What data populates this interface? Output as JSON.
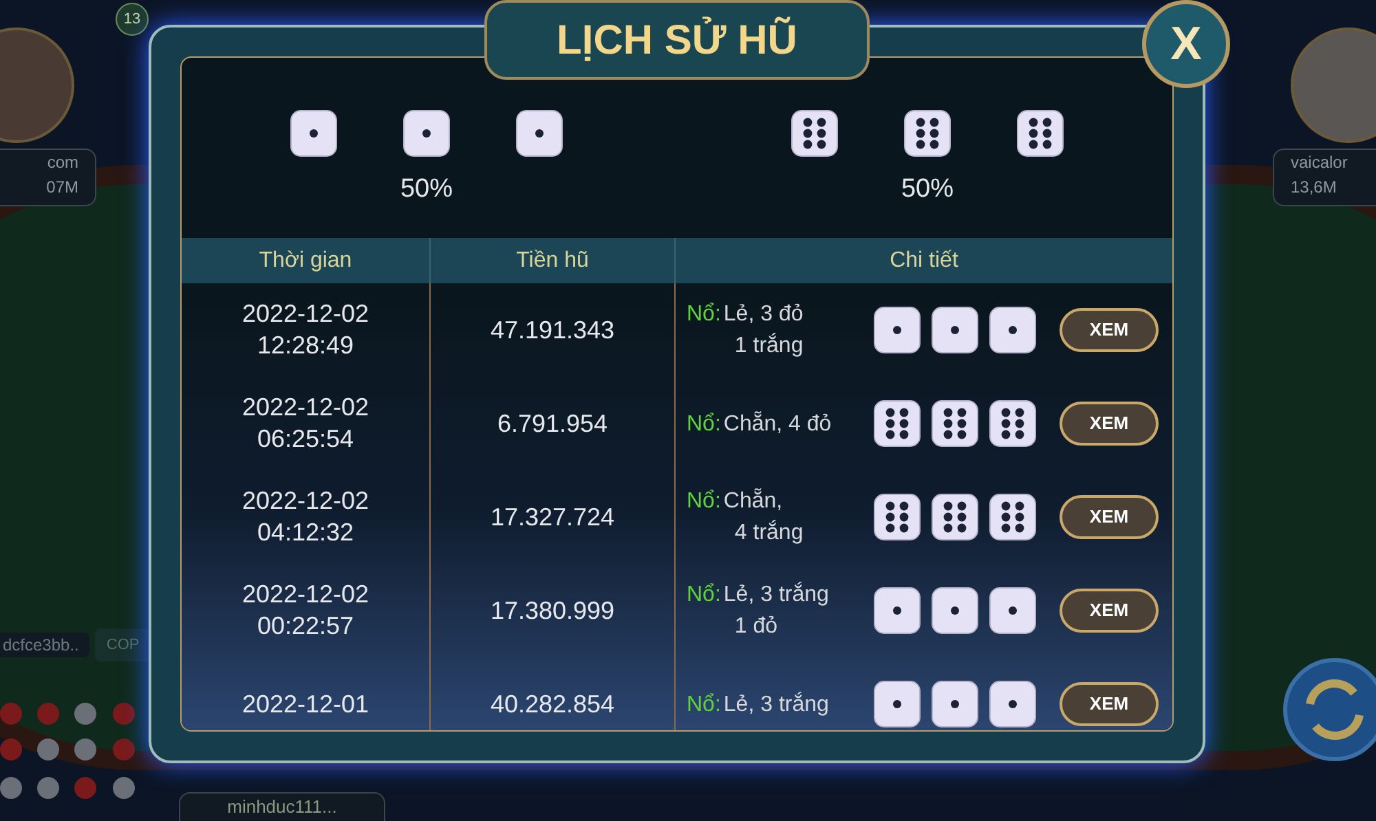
{
  "background": {
    "left_player": {
      "name": "com",
      "balance": "07M",
      "level": "13"
    },
    "right_player": {
      "name": "vaicalor",
      "balance": "13,6M"
    },
    "room_code": "dcfce3bb..",
    "copy_button": "COP",
    "bottom_player": "minhduc111..."
  },
  "dialog": {
    "title": "LỊCH SỬ HŨ",
    "close": "X",
    "jackpots": [
      {
        "dice": [
          {
            "kind": "one"
          },
          {
            "kind": "one"
          },
          {
            "kind": "one"
          }
        ],
        "chance": "50%"
      },
      {
        "dice": [
          {
            "kind": "six"
          },
          {
            "kind": "six"
          },
          {
            "kind": "six"
          }
        ],
        "chance": "50%"
      }
    ],
    "table": {
      "columns": [
        "Thời gian",
        "Tiền hũ",
        "Chi tiết"
      ],
      "rows": [
        {
          "date": "2022-12-02",
          "time": "12:28:49",
          "amount": "47.191.343",
          "prefix": "Nổ:",
          "lines": [
            "Lẻ, 3 đỏ",
            "1 trắng"
          ],
          "dice": [
            {
              "kind": "one"
            },
            {
              "kind": "one"
            },
            {
              "kind": "one"
            }
          ],
          "button": "XEM"
        },
        {
          "date": "2022-12-02",
          "time": "06:25:54",
          "amount": "6.791.954",
          "prefix": "Nổ:",
          "lines": [
            "Chẵn, 4 đỏ"
          ],
          "dice": [
            {
              "kind": "six"
            },
            {
              "kind": "six"
            },
            {
              "kind": "six"
            }
          ],
          "button": "XEM"
        },
        {
          "date": "2022-12-02",
          "time": "04:12:32",
          "amount": "17.327.724",
          "prefix": "Nổ:",
          "lines": [
            "Chẵn,",
            "4 trắng"
          ],
          "dice": [
            {
              "kind": "six"
            },
            {
              "kind": "six"
            },
            {
              "kind": "six"
            }
          ],
          "button": "XEM"
        },
        {
          "date": "2022-12-02",
          "time": "00:22:57",
          "amount": "17.380.999",
          "prefix": "Nổ:",
          "lines": [
            "Lẻ, 3 trắng",
            "1 đỏ"
          ],
          "dice": [
            {
              "kind": "one"
            },
            {
              "kind": "one"
            },
            {
              "kind": "one"
            }
          ],
          "button": "XEM"
        },
        {
          "date": "2022-12-01",
          "amount": "40.282.854",
          "prefix": "Nổ:",
          "lines": [
            "Lẻ, 3 trắng"
          ],
          "dice": [
            {
              "kind": "one"
            },
            {
              "kind": "one"
            },
            {
              "kind": "one"
            }
          ],
          "button": "XEM"
        }
      ]
    }
  }
}
